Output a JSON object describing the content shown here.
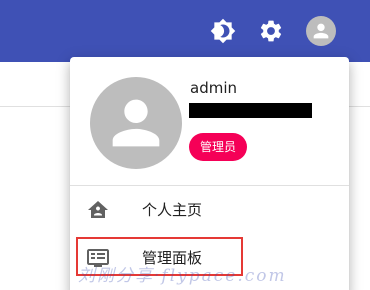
{
  "appbar": {
    "color": "#3f51b5",
    "icons": [
      "theme-toggle-icon",
      "settings-icon",
      "account-avatar-icon"
    ]
  },
  "user_menu": {
    "username": "admin",
    "role_badge": "管理员",
    "role_badge_color": "#f50057",
    "items": [
      {
        "label": "个人主页",
        "icon": "home-icon"
      },
      {
        "label": "管理面板",
        "icon": "dashboard-icon"
      }
    ]
  },
  "annotation": {
    "highlight_color": "#e53935",
    "watermark": "刘刚分享·flypace.com"
  }
}
